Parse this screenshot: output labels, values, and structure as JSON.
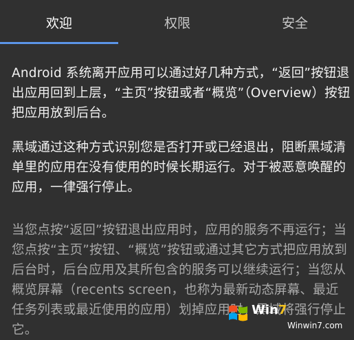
{
  "tabs": [
    {
      "label": "欢迎",
      "active": true
    },
    {
      "label": "权限",
      "active": false
    },
    {
      "label": "安全",
      "active": false
    }
  ],
  "colors": {
    "background": "#303030",
    "tab_indicator": "#5b95e8",
    "text_primary": "#f2f2f2",
    "text_secondary": "#a9a9a9"
  },
  "content": {
    "paragraph_1": "Android 系统离开应用可以通过好几种方式，“返回”按钮退出应用回到上层，“主页”按钮或者“概览”（Overview）按钮把应用放到后台。",
    "paragraph_2": "黑域通过这种方式识别您是否打开或已经退出，阻断黑域清单里的应用在没有使用的时候长期运行。对于被恶意唤醒的应用，一律强行停止。",
    "paragraph_3": "当您点按“返回”按钮退出应用时，应用的服务不再运行；当您点按“主页”按钮、“概览”按钮或通过其它方式把应用放到后台时，后台应用及其所包含的服务可以继续运行；当您从概览屏幕（recents screen，也称为最新动态屏幕、最近任务列表或最近使用的应用）划掉应用时，黑域将强行停止它。"
  },
  "watermark": {
    "brand_prefix": "Win",
    "brand_suffix": "7",
    "url": "Winwin7.com",
    "icon": "windows-flag-icon"
  }
}
